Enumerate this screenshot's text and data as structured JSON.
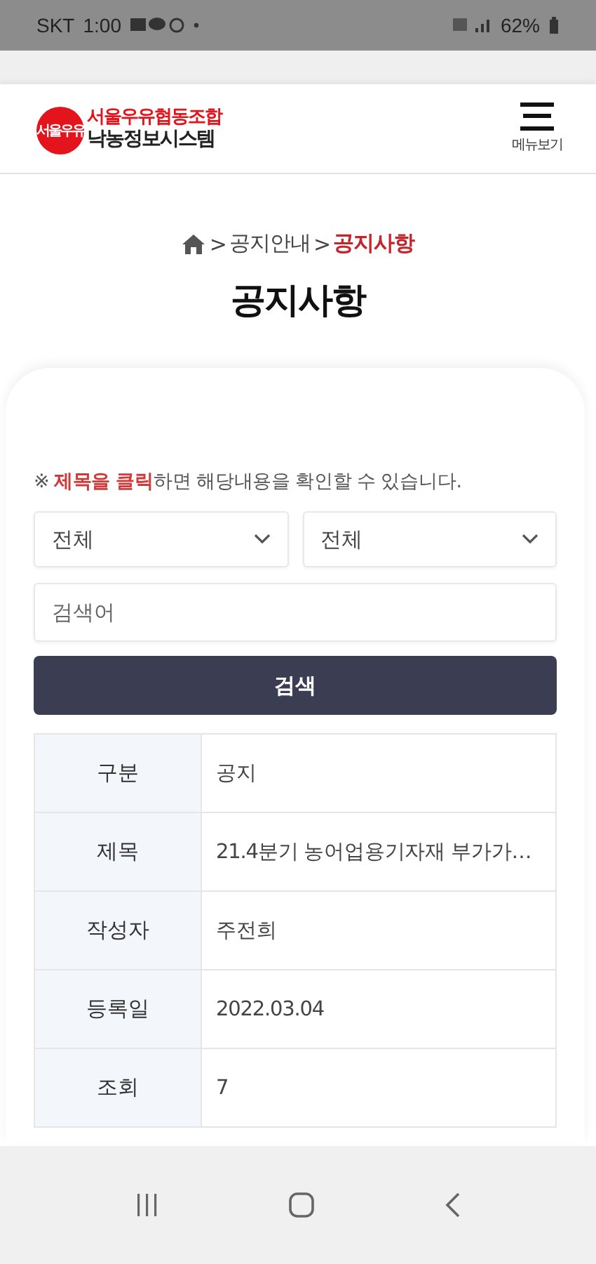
{
  "status_bar": {
    "carrier": "SKT",
    "time": "1:00",
    "battery": "62%"
  },
  "header": {
    "logo_top": "서울우유협동조합",
    "logo_bottom": "낙농정보시스템",
    "logo_badge": "서울우유",
    "menu_label": "메뉴보기"
  },
  "breadcrumb": [
    {
      "label": "공지안내",
      "current": false
    },
    {
      "label": "공지사항",
      "current": true
    }
  ],
  "breadcrumb_separator": ">",
  "title": "공지사항",
  "notice": "※ **제목을 클릭**하면 해당내용을 확인할 수 있습니다.",
  "filters": [
    {
      "value": "전체"
    },
    {
      "value": "전체"
    }
  ],
  "search": {
    "placeholder": "검색어"
  },
  "search_button": "검색",
  "posts": [
    {
      "fields": [
        {
          "label": "구분",
          "value": "공지"
        },
        {
          "label": "제목",
          "value": "21.4분기 농어업용기자재 부가가…"
        },
        {
          "label": "작성자",
          "value": "주전희"
        },
        {
          "label": "등록일",
          "value": "2022.03.04"
        },
        {
          "label": "조회",
          "value": "7"
        }
      ]
    }
  ]
}
